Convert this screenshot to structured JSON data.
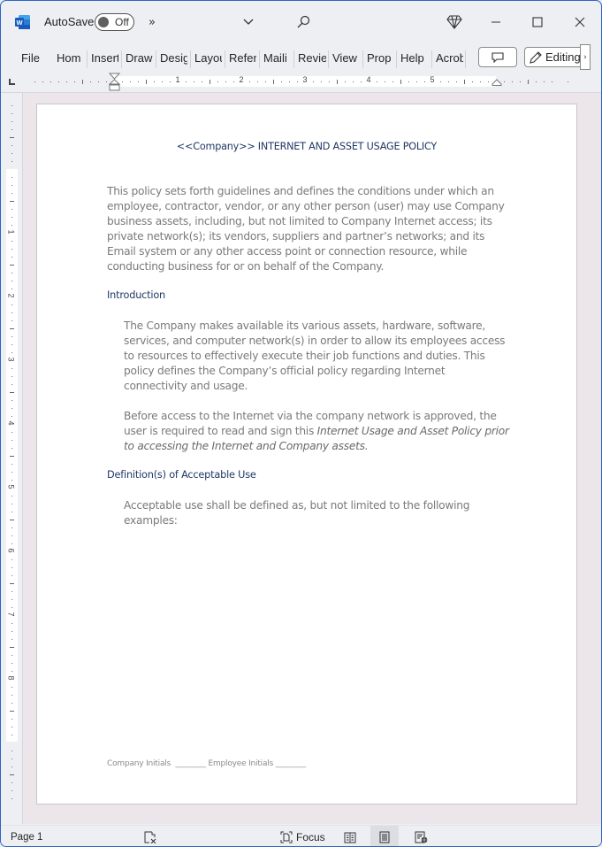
{
  "titlebar": {
    "app_icon": "word-icon",
    "autosave_label": "AutoSave",
    "autosave_state": "Off",
    "overflow_glyph": "»",
    "icons": [
      "customize-qat-chevron-icon",
      "search-icon",
      "premium-diamond-icon",
      "minimize-icon",
      "maximize-icon",
      "close-icon"
    ]
  },
  "ribbon": {
    "tabs": [
      "File",
      "Home",
      "Insert",
      "Draw",
      "Design",
      "Layout",
      "References",
      "Mailings",
      "Review",
      "View",
      "Properties",
      "Help",
      "Acrobat"
    ],
    "tabs_visible": [
      "File",
      "Hom",
      "Insert",
      "Draw",
      "Desig",
      "Layou",
      "Refer",
      "Maili",
      "Revie",
      "View",
      "Prop",
      "Help",
      "Acrob"
    ],
    "comment_button": "comment-icon",
    "editing_label": "Editing",
    "more_glyph": "›"
  },
  "ruler": {
    "horizontal_numbers": [
      "1",
      "2",
      "3",
      "4",
      "5"
    ],
    "vertical_numbers": [
      "1",
      "2",
      "3",
      "4",
      "5",
      "6",
      "7",
      "8"
    ]
  },
  "document": {
    "title": "<<Company>> INTERNET AND ASSET USAGE POLICY",
    "intro_paragraph": "This policy sets forth guidelines and defines the conditions under which an employee, contractor, vendor, or any other person (user) may use Company business assets, including, but not limited to Company Internet access; its private network(s); its vendors, suppliers and partner’s networks; and its Email system or any other access point or connection resource, while conducting business for or on behalf of the Company.",
    "sections": [
      {
        "heading": "Introduction",
        "paragraphs": [
          {
            "text": "The Company makes available its various assets, hardware, software, services, and computer network(s) in order to allow its employees access to resources to effectively execute their job functions and duties. This policy defines the Company’s official policy regarding Internet connectivity and usage."
          },
          {
            "text": "Before access to the Internet via the company network is approved, the user is required to read and sign this ",
            "italic": "Internet Usage and Asset Policy prior to accessing the Internet and Company assets."
          }
        ]
      },
      {
        "heading": "Definition(s) of Acceptable Use",
        "paragraphs": [
          {
            "text": "Acceptable use shall be defined as, but not limited to the following examples:"
          }
        ]
      }
    ],
    "footer": "Company Initials  ________ Employee Initials ________"
  },
  "statusbar": {
    "page_label": "Page 1",
    "focus_label": "Focus",
    "view_icons": [
      "read-mode-icon",
      "print-layout-icon",
      "web-layout-icon"
    ],
    "active_view": "print-layout"
  },
  "colors": {
    "window_border": "#2b64c8",
    "heading": "#1f3864",
    "body_text": "#7a7a7a",
    "word_brand": "#185abd"
  }
}
